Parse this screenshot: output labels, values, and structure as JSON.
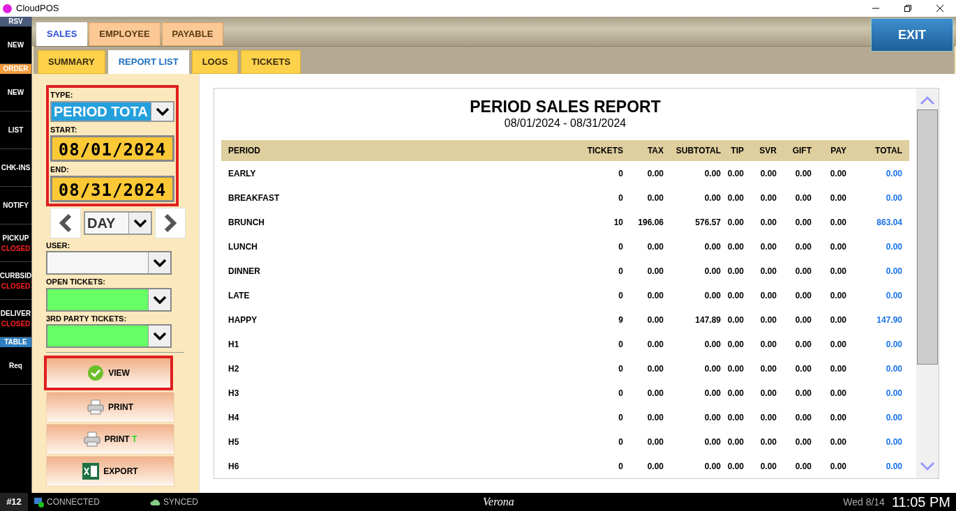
{
  "window": {
    "title": "CloudPOS"
  },
  "sidebar": [
    {
      "kind": "header",
      "label": "RSV",
      "color": "#4a5a7a"
    },
    {
      "kind": "button",
      "label": "NEW"
    },
    {
      "kind": "header",
      "label": "ORDER",
      "color": "#f39a3a"
    },
    {
      "kind": "button",
      "label": "NEW"
    },
    {
      "kind": "button",
      "label": "LIST"
    },
    {
      "kind": "button",
      "label": "CHK-INS"
    },
    {
      "kind": "button",
      "label": "NOTIFY"
    },
    {
      "kind": "button",
      "label": "PICKUP",
      "status": "CLOSED"
    },
    {
      "kind": "button",
      "label": "CURBSID",
      "status": "CLOSED"
    },
    {
      "kind": "button",
      "label": "DELIVER",
      "status": "CLOSED"
    },
    {
      "kind": "header",
      "label": "TABLE",
      "color": "#2f7fc0"
    },
    {
      "kind": "button",
      "label": "Req"
    }
  ],
  "tabs": [
    {
      "label": "SALES",
      "selected": true
    },
    {
      "label": "EMPLOYEE",
      "selected": false
    },
    {
      "label": "PAYABLE",
      "selected": false
    }
  ],
  "exit_button": "EXIT",
  "subtabs": [
    {
      "label": "SUMMARY",
      "selected": false
    },
    {
      "label": "REPORT LIST",
      "selected": true
    },
    {
      "label": "LOGS",
      "selected": false
    },
    {
      "label": "TICKETS",
      "selected": false
    }
  ],
  "filters": {
    "type_label": "TYPE:",
    "type_value": "PERIOD TOTA",
    "start_label": "START:",
    "start_value": "08/01/2024",
    "end_label": "END:",
    "end_value": "08/31/2024",
    "step_value": "DAY",
    "dropdowns": [
      {
        "label": "USER:",
        "active": false
      },
      {
        "label": "OPEN TICKETS:",
        "active": true
      },
      {
        "label": "3RD PARTY TICKETS:",
        "active": true
      }
    ]
  },
  "actions": [
    {
      "kind": "view",
      "label": "VIEW",
      "highlighted": true
    },
    {
      "kind": "print",
      "label": "PRINT",
      "highlighted": false
    },
    {
      "kind": "print",
      "label": "PRINT **T**",
      "highlighted": false
    },
    {
      "kind": "export",
      "label": "EXPORT",
      "highlighted": false
    }
  ],
  "report": {
    "title": "PERIOD SALES REPORT",
    "range": "08/01/2024 - 08/31/2024",
    "columns": [
      "PERIOD",
      "TICKETS",
      "TAX",
      "SUBTOTAL",
      "TIP",
      "SVR",
      "GIFT",
      "PAY",
      "TOTAL"
    ],
    "rows": [
      [
        "EARLY",
        "0",
        "0.00",
        "0.00",
        "0.00",
        "0.00",
        "0.00",
        "0.00",
        "0.00"
      ],
      [
        "BREAKFAST",
        "0",
        "0.00",
        "0.00",
        "0.00",
        "0.00",
        "0.00",
        "0.00",
        "0.00"
      ],
      [
        "BRUNCH",
        "10",
        "196.06",
        "576.57",
        "0.00",
        "0.00",
        "0.00",
        "0.00",
        "863.04"
      ],
      [
        "LUNCH",
        "0",
        "0.00",
        "0.00",
        "0.00",
        "0.00",
        "0.00",
        "0.00",
        "0.00"
      ],
      [
        "DINNER",
        "0",
        "0.00",
        "0.00",
        "0.00",
        "0.00",
        "0.00",
        "0.00",
        "0.00"
      ],
      [
        "LATE",
        "0",
        "0.00",
        "0.00",
        "0.00",
        "0.00",
        "0.00",
        "0.00",
        "0.00"
      ],
      [
        "HAPPY",
        "9",
        "0.00",
        "147.89",
        "0.00",
        "0.00",
        "0.00",
        "0.00",
        "147.90"
      ],
      [
        "H1",
        "0",
        "0.00",
        "0.00",
        "0.00",
        "0.00",
        "0.00",
        "0.00",
        "0.00"
      ],
      [
        "H2",
        "0",
        "0.00",
        "0.00",
        "0.00",
        "0.00",
        "0.00",
        "0.00",
        "0.00"
      ],
      [
        "H3",
        "0",
        "0.00",
        "0.00",
        "0.00",
        "0.00",
        "0.00",
        "0.00",
        "0.00"
      ],
      [
        "H4",
        "0",
        "0.00",
        "0.00",
        "0.00",
        "0.00",
        "0.00",
        "0.00",
        "0.00"
      ],
      [
        "H5",
        "0",
        "0.00",
        "0.00",
        "0.00",
        "0.00",
        "0.00",
        "0.00",
        "0.00"
      ],
      [
        "H6",
        "0",
        "0.00",
        "0.00",
        "0.00",
        "0.00",
        "0.00",
        "0.00",
        "0.00"
      ]
    ]
  },
  "status_bar": {
    "station": "#12",
    "connection": "CONNECTED",
    "sync": "SYNCED",
    "location": "Verona",
    "date": "Wed 8/14",
    "time": "11:05 PM"
  }
}
